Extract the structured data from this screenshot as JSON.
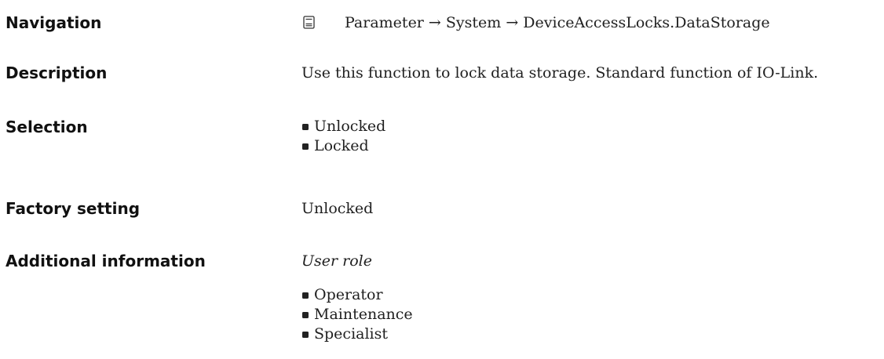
{
  "navigation": {
    "label": "Navigation",
    "icon": "menu-icon",
    "path": "Parameter → System → DeviceAccessLocks.DataStorage"
  },
  "description": {
    "label": "Description",
    "text": "Use this function to lock data storage. Standard function of IO-Link."
  },
  "selection": {
    "label": "Selection",
    "options": [
      "Unlocked",
      "Locked"
    ]
  },
  "factory_setting": {
    "label": "Factory setting",
    "value": "Unlocked"
  },
  "additional_information": {
    "label": "Additional information",
    "subheading": "User role",
    "roles": [
      "Operator",
      "Maintenance",
      "Specialist"
    ]
  }
}
